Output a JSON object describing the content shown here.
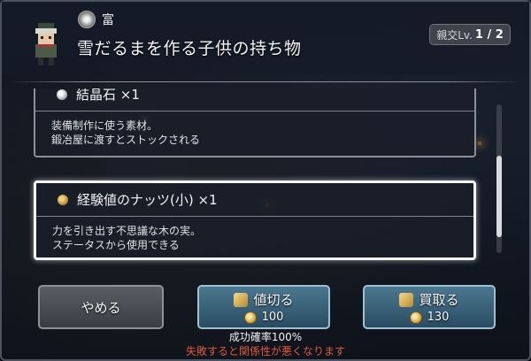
{
  "header": {
    "trait_icon": "wealth-emblem-icon",
    "trait_label": "富",
    "title": "雪だるまを作る子供の持ち物",
    "friendship_label": "親交Lv.",
    "friendship_value": "1 / 2"
  },
  "items": [
    {
      "icon": "crystal-icon",
      "name": "結晶石 ×1",
      "desc_line1": "装備制作に使う素材。",
      "desc_line2": "鍛冶屋に渡すとストックされる"
    },
    {
      "icon": "nut-icon",
      "name": "経験値のナッツ(小) ×1",
      "desc_line1": "力を引き出す不思議な木の実。",
      "desc_line2": "ステータスから使用できる",
      "selected": true
    }
  ],
  "buttons": {
    "cancel": "やめる",
    "haggle": {
      "label": "値切る",
      "icon": "haggle-icon",
      "cost": "100"
    },
    "buy": {
      "label": "買取る",
      "icon": "buy-icon",
      "cost": "130"
    }
  },
  "footer": {
    "success_rate": "成功確率100%",
    "warning": "失敗すると関係性が悪くなります"
  },
  "colors": {
    "accent_button": "#3a6680",
    "warning_text": "#e0583c",
    "selected_border": "#f5f5f7"
  }
}
